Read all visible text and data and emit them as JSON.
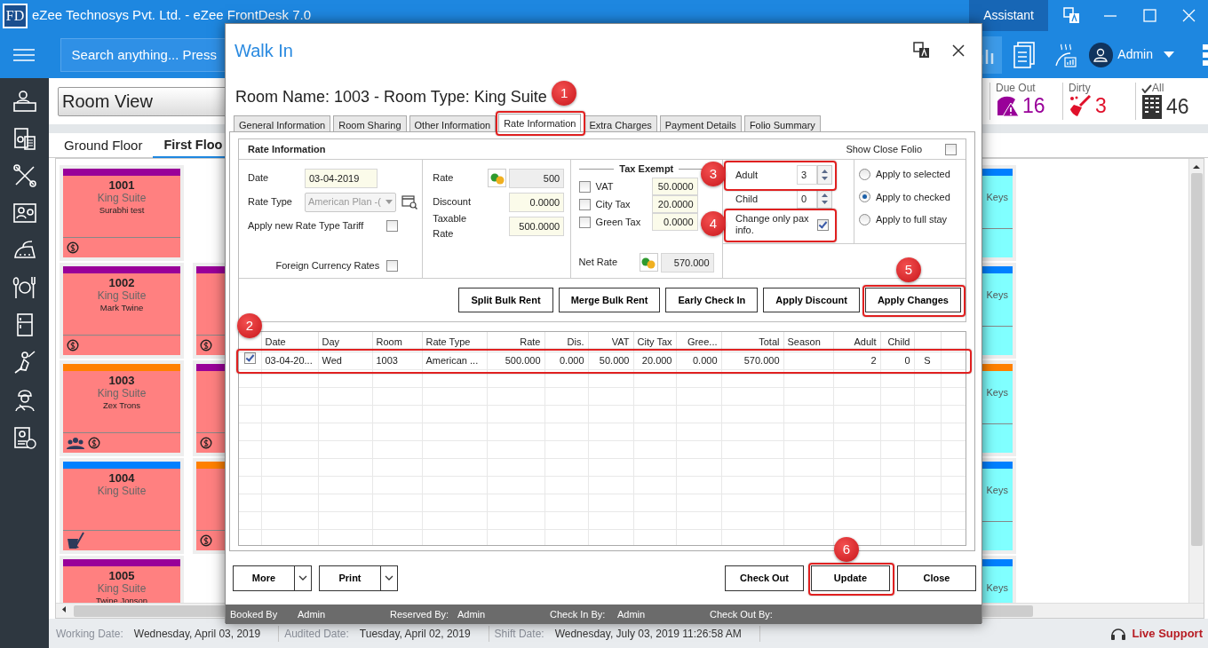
{
  "window": {
    "logo": "FD",
    "title": "eZee Technosys Pvt. Ltd. - eZee FrontDesk 7.0",
    "assistant": "Assistant"
  },
  "top_bar": {
    "search": {
      "placeholder": "Search anything... Press"
    },
    "user": "Admin"
  },
  "view_select": {
    "value": "Room View"
  },
  "stats": [
    {
      "kind": "due_out",
      "label": "Due Out",
      "count": "16"
    },
    {
      "kind": "dirty",
      "label": "Dirty",
      "count": "3"
    },
    {
      "kind": "all",
      "label": "All",
      "count": "46"
    }
  ],
  "floor_tabs": [
    {
      "label": "Ground Floor",
      "selected": false
    },
    {
      "label": "First Floo",
      "selected": true
    }
  ],
  "room_rows": [
    {
      "cards": [
        {
          "kind": "full",
          "number": "1001",
          "type": "King Suite",
          "guest": "Surabhi test",
          "color": "#990099",
          "icons": [
            {
              "kind": "coin"
            }
          ]
        },
        {
          "kind": "side",
          "color": "#0080ff",
          "text": "Keys"
        }
      ]
    },
    {
      "cards": [
        {
          "kind": "full",
          "number": "1002",
          "type": "King Suite",
          "guest": "Mark Twine",
          "color": "#990099",
          "icons": [
            {
              "kind": "coin"
            }
          ]
        },
        {
          "kind": "partial",
          "color": "#990099",
          "icons": [
            {
              "kind": "coin"
            }
          ]
        },
        {
          "kind": "side",
          "color": "#0080ff",
          "text": "Keys"
        }
      ]
    },
    {
      "cards": [
        {
          "kind": "full",
          "number": "1003",
          "type": "King Suite",
          "guest": "Zex Trons",
          "color": "#ff8000",
          "icons": [
            {
              "kind": "group"
            },
            {
              "kind": "coin"
            }
          ]
        },
        {
          "kind": "partial",
          "color": "#990099",
          "icons": [
            {
              "kind": "coin"
            }
          ]
        },
        {
          "kind": "side",
          "color": "#ff8000",
          "text": "Keys"
        }
      ]
    },
    {
      "cards": [
        {
          "kind": "full",
          "number": "1004",
          "type": "King Suite",
          "color": "#0080ff",
          "icons": [
            {
              "kind": "cleaning"
            }
          ]
        },
        {
          "kind": "partial",
          "color": "#ff8000",
          "icons": [
            {
              "kind": "coin"
            }
          ]
        },
        {
          "kind": "side",
          "color": "#0080ff",
          "text": "Keys"
        }
      ]
    },
    {
      "cards": [
        {
          "kind": "full",
          "number": "1005",
          "type": "King Suite",
          "guest": "Twine Jonson",
          "color": "#990099"
        },
        {
          "kind": "side",
          "color": "#0080ff",
          "text": "Keys"
        }
      ]
    }
  ],
  "status_bar": {
    "items": [
      {
        "label": "Working Date:",
        "value": "Wednesday, April 03, 2019"
      },
      {
        "label": "Audited Date:",
        "value": "Tuesday, April 02, 2019"
      },
      {
        "label": "Shift Date:",
        "value": "Wednesday, July 03, 2019 11:26:58 AM"
      }
    ],
    "support": "Live Support"
  },
  "dialog": {
    "title": "Walk In",
    "heading": "Room Name: 1003 - Room Type: King Suite",
    "tabs": [
      {
        "label": "General Information",
        "selected": false
      },
      {
        "label": "Room Sharing",
        "selected": false
      },
      {
        "label": "Other Information",
        "selected": false
      },
      {
        "label": "Rate Information",
        "selected": true,
        "callout": "1"
      },
      {
        "label": "Extra Charges",
        "selected": false
      },
      {
        "label": "Payment Details",
        "selected": false
      },
      {
        "label": "Folio Summary",
        "selected": false
      }
    ],
    "group_title": "Rate Information",
    "show_close_folio": {
      "label": "Show Close Folio",
      "checked": false
    },
    "date": {
      "label": "Date",
      "value": "03-04-2019"
    },
    "rate_type": {
      "label": "Rate Type",
      "value": "American Plan -(",
      "disabled": true
    },
    "apply_new_tariff": {
      "label": "Apply new Rate Type Tariff",
      "checked": false
    },
    "foreign_currency": {
      "label": "Foreign Currency Rates",
      "checked": false
    },
    "rate_fields": [
      {
        "kind": "currency",
        "label": "Rate",
        "value": "500"
      },
      {
        "kind": "plain",
        "label": "Discount",
        "value": "0.0000"
      },
      {
        "kind": "plain",
        "label": "Taxable Rate",
        "value": "500.0000"
      }
    ],
    "tax_exempt": {
      "title": "Tax Exempt",
      "taxes": [
        {
          "label": "VAT",
          "value": "50.0000",
          "checked": false
        },
        {
          "label": "City Tax",
          "value": "20.0000",
          "checked": false
        },
        {
          "label": "Green Tax",
          "value": "0.0000",
          "checked": false
        }
      ]
    },
    "net_rate": {
      "label": "Net Rate",
      "value": "570.000"
    },
    "pax": [
      {
        "label": "Adult",
        "value": "3",
        "callout": "3"
      },
      {
        "label": "Child",
        "value": "0"
      }
    ],
    "pax_only": {
      "label": "Change only pax info.",
      "checked": true,
      "callout": "4"
    },
    "apply_options": [
      {
        "label": "Apply to selected",
        "selected": false
      },
      {
        "label": "Apply to checked",
        "selected": true
      },
      {
        "label": "Apply to full stay",
        "selected": false
      }
    ],
    "actions": [
      {
        "label": "Split Bulk Rent"
      },
      {
        "label": "Merge Bulk Rent"
      },
      {
        "label": "Early Check In"
      },
      {
        "label": "Apply Discount"
      },
      {
        "label": "Apply Changes",
        "callout": "5"
      }
    ],
    "grid": {
      "columns": [
        {
          "label": "Date",
          "kind": "text"
        },
        {
          "label": "Day",
          "kind": "text"
        },
        {
          "label": "Room",
          "kind": "text"
        },
        {
          "label": "Rate Type",
          "kind": "text"
        },
        {
          "label": "Rate",
          "kind": "number"
        },
        {
          "label": "Dis.",
          "kind": "number"
        },
        {
          "label": "VAT",
          "kind": "number"
        },
        {
          "label": "City Tax",
          "kind": "number"
        },
        {
          "label": "Gree...",
          "kind": "number"
        },
        {
          "label": "Total",
          "kind": "number"
        },
        {
          "label": "Season",
          "kind": "text"
        },
        {
          "label": "Adult",
          "kind": "number"
        },
        {
          "label": "Child",
          "kind": "number"
        },
        {
          "kind": "flag"
        }
      ],
      "rows": [
        {
          "checked": true,
          "callout": "2",
          "cells": [
            "03-04-20...",
            "Wed",
            "1003",
            "American ...",
            "500.000",
            "0.000",
            "50.000",
            "20.000",
            "0.000",
            "570.000",
            null,
            "2",
            "0",
            "S"
          ]
        }
      ]
    },
    "footer_buttons": [
      {
        "kind": "split",
        "label": "More"
      },
      {
        "kind": "split",
        "label": "Print"
      },
      {
        "kind": "plain",
        "label": "Check Out"
      },
      {
        "kind": "plain",
        "label": "Update",
        "callout": "6"
      },
      {
        "kind": "plain",
        "label": "Close"
      }
    ],
    "info_strip": [
      {
        "label": "Booked By",
        "value": "Admin"
      },
      {
        "label": "Reserved By:",
        "value": "Admin"
      },
      {
        "label": "Check In By:",
        "value": "Admin"
      },
      {
        "label": "Check Out By:"
      }
    ]
  }
}
